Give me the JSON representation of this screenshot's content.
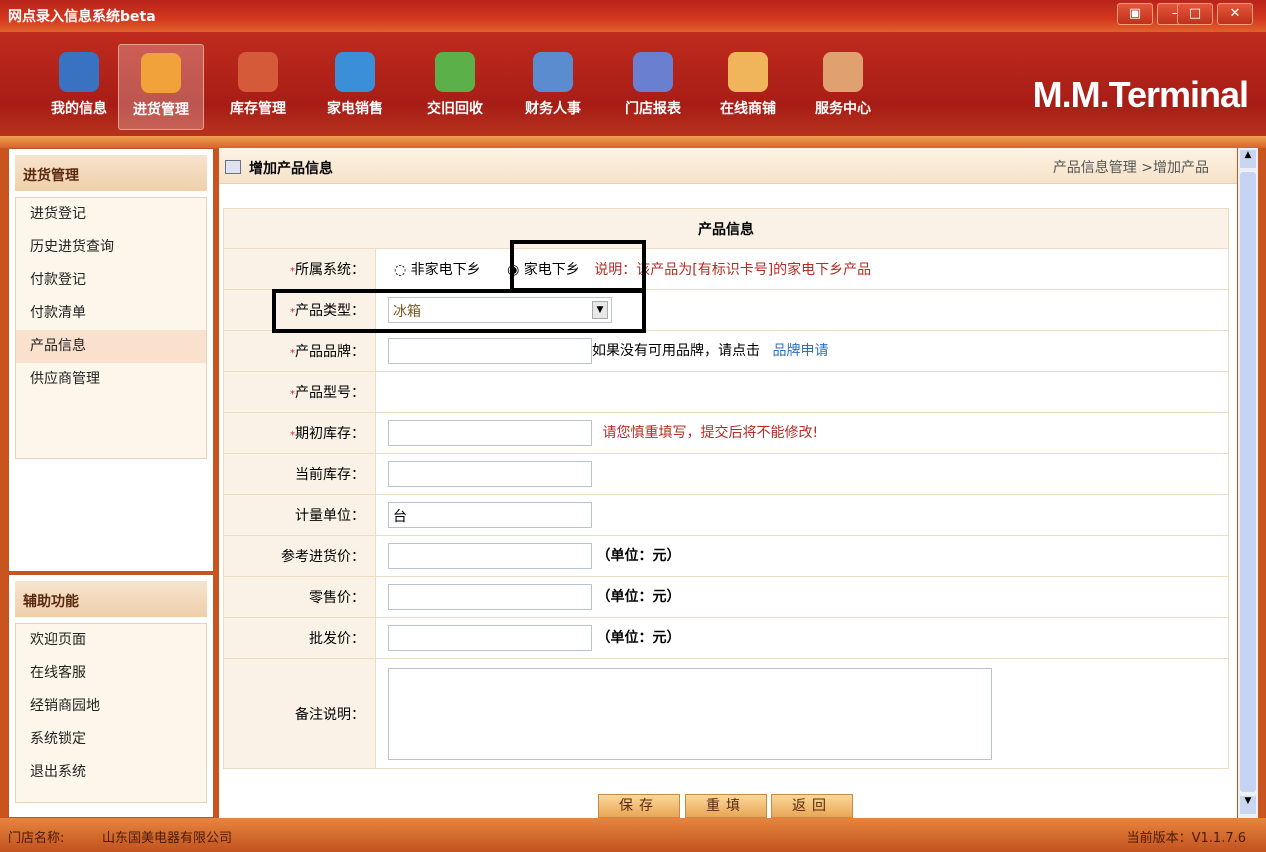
{
  "window": {
    "title": "网点录入信息系统beta",
    "controls": [
      "▣",
      "–",
      "□",
      "✕"
    ]
  },
  "nav": {
    "items": [
      {
        "label": "我的信息",
        "icon": "user-icon",
        "color": "#3a72c2"
      },
      {
        "label": "进货管理",
        "icon": "cart-icon",
        "color": "#f2a23a",
        "active": true
      },
      {
        "label": "库存管理",
        "icon": "boxes-icon",
        "color": "#d45a3a"
      },
      {
        "label": "家电销售",
        "icon": "pie-chart-icon",
        "color": "#3b8fd8"
      },
      {
        "label": "交旧回收",
        "icon": "recycle-icon",
        "color": "#5bb04a"
      },
      {
        "label": "财务人事",
        "icon": "money-card-icon",
        "color": "#5a8ccf"
      },
      {
        "label": "门店报表",
        "icon": "bar-report-icon",
        "color": "#6a7fd0"
      },
      {
        "label": "在线商铺",
        "icon": "house-icon",
        "color": "#f0b45a"
      },
      {
        "label": "服务中心",
        "icon": "service-agent-icon",
        "color": "#e0a070"
      }
    ],
    "logo": "M.M.Terminal"
  },
  "sidebar": {
    "panel1": {
      "title": "进货管理",
      "items": [
        "进货登记",
        "历史进货查询",
        "付款登记",
        "付款清单",
        "产品信息",
        "供应商管理"
      ],
      "selected": 4
    },
    "panel2": {
      "title": "辅助功能",
      "items": [
        "欢迎页面",
        "在线客服",
        "经销商园地",
        "系统锁定",
        "退出系统"
      ]
    }
  },
  "main": {
    "title": "增加产品信息",
    "breadcrumb": "产品信息管理 >增加产品",
    "form": {
      "header": "产品信息",
      "system": {
        "label": "所属系统：",
        "options": [
          "非家电下乡",
          "家电下乡"
        ],
        "selected": 1,
        "note": "说明：该产品为[有标识卡号]的家电下乡产品"
      },
      "type": {
        "label": "产品类型：",
        "value": "冰箱"
      },
      "brand": {
        "label": "产品品牌：",
        "value": "",
        "hint": "如果没有可用品牌，请点击",
        "link": "品牌申请"
      },
      "model": {
        "label": "产品型号："
      },
      "initial_stock": {
        "label": "期初库存：",
        "value": "",
        "warning": "请您慎重填写，提交后将不能修改!"
      },
      "current_stock": {
        "label": "当前库存：",
        "value": ""
      },
      "unit": {
        "label": "计量单位：",
        "value": "台"
      },
      "ref_price": {
        "label": "参考进货价：",
        "value": "",
        "unit": "（单位：元）"
      },
      "retail_price": {
        "label": "零售价：",
        "value": "",
        "unit": "（单位：元）"
      },
      "wholesale_price": {
        "label": "批发价：",
        "value": "",
        "unit": "（单位：元）"
      },
      "remarks": {
        "label": "备注说明：",
        "value": ""
      }
    },
    "buttons": {
      "save": "保存",
      "reset": "重填",
      "back": "返回"
    }
  },
  "footer": {
    "store_label": "门店名称:",
    "store": "山东国美电器有限公司",
    "version": "当前版本：V1.1.7.6"
  }
}
